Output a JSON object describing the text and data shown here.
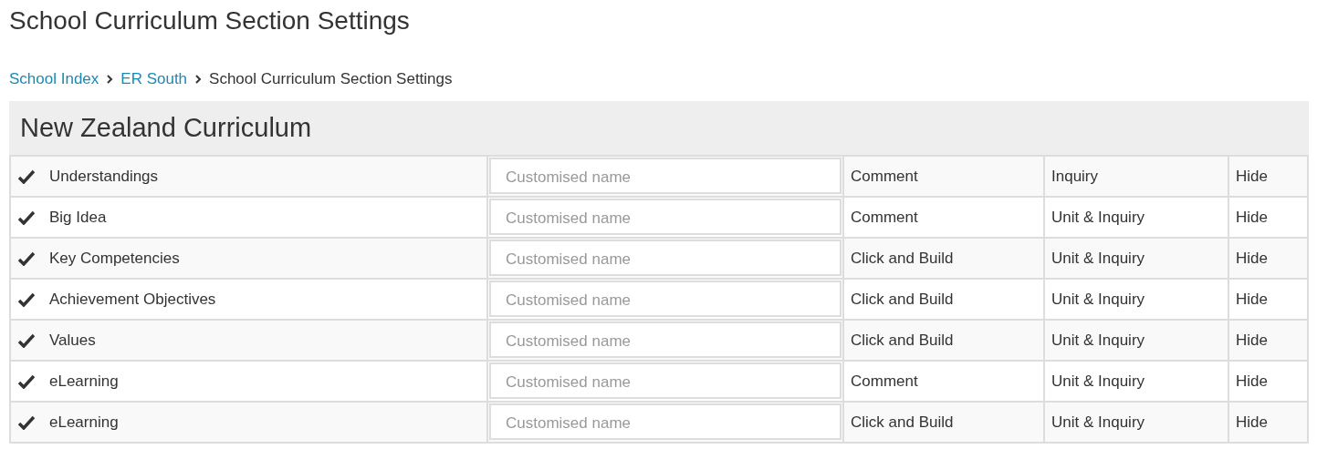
{
  "title": "School Curriculum Section Settings",
  "breadcrumb": [
    {
      "label": "School Index",
      "kind": "link"
    },
    {
      "label": "ER South",
      "kind": "link"
    },
    {
      "label": "School Curriculum Section Settings",
      "kind": "current"
    }
  ],
  "section": {
    "title": "New Zealand Curriculum",
    "rows": [
      {
        "checked": true,
        "name": "Understandings",
        "placeholder": "Customised name",
        "column_3": "Comment",
        "column_4": "Inquiry",
        "column_5": "Hide"
      },
      {
        "checked": true,
        "name": "Big Idea",
        "placeholder": "Customised name",
        "column_3": "Comment",
        "column_4": "Unit & Inquiry",
        "column_5": "Hide"
      },
      {
        "checked": true,
        "name": "Key Competencies",
        "placeholder": "Customised name",
        "column_3": "Click and Build",
        "column_4": "Unit & Inquiry",
        "column_5": "Hide"
      },
      {
        "checked": true,
        "name": "Achievement Objectives",
        "placeholder": "Customised name",
        "column_3": "Click and Build",
        "column_4": "Unit & Inquiry",
        "column_5": "Hide"
      },
      {
        "checked": true,
        "name": "Values",
        "placeholder": "Customised name",
        "column_3": "Click and Build",
        "column_4": "Unit & Inquiry",
        "column_5": "Hide"
      },
      {
        "checked": true,
        "name": "eLearning",
        "placeholder": "Customised name",
        "column_3": "Comment",
        "column_4": "Unit & Inquiry",
        "column_5": "Hide"
      },
      {
        "checked": true,
        "name": "eLearning",
        "placeholder": "Customised name",
        "column_3": "Click and Build",
        "column_4": "Unit & Inquiry",
        "column_5": "Hide"
      }
    ]
  }
}
